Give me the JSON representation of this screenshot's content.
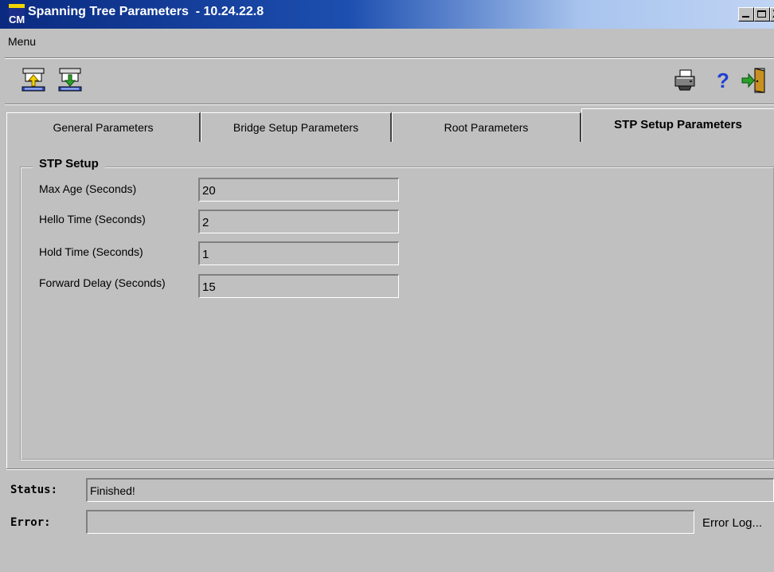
{
  "window": {
    "title": "Spanning Tree Parameters  - 10.24.22.8",
    "app_icon_text": "CM",
    "controls": {
      "close_glyph": "X"
    }
  },
  "menu": {
    "label": "Menu"
  },
  "toolbar": {
    "icons": [
      "upload-to-device-icon",
      "download-from-device-icon",
      "printer-icon",
      "help-icon",
      "exit-door-icon"
    ],
    "help_glyph": "?"
  },
  "tabs": [
    {
      "label": "General Parameters"
    },
    {
      "label": "Bridge Setup Parameters"
    },
    {
      "label": "Root Parameters"
    },
    {
      "label": "STP Setup Parameters",
      "selected": true
    }
  ],
  "stp_setup": {
    "title": "STP Setup",
    "fields": [
      {
        "label": "Max Age (Seconds)",
        "value": "20"
      },
      {
        "label": "Hello Time (Seconds)",
        "value": "2"
      },
      {
        "label": "Hold Time (Seconds)",
        "value": "1"
      },
      {
        "label": "Forward Delay (Seconds)",
        "value": "15"
      }
    ]
  },
  "status": {
    "status_label": "Status:",
    "status_value": "Finished!",
    "error_label": "Error:",
    "error_value": "",
    "error_log_label": "Error Log..."
  },
  "colors": {
    "window_bg": "#c0c0c0",
    "titlebar_start": "#0a2a80",
    "titlebar_end": "#c0d4f4",
    "help_blue": "#1f3fd0",
    "download_green": "#2aa02a",
    "upload_yellow": "#f2d400"
  }
}
